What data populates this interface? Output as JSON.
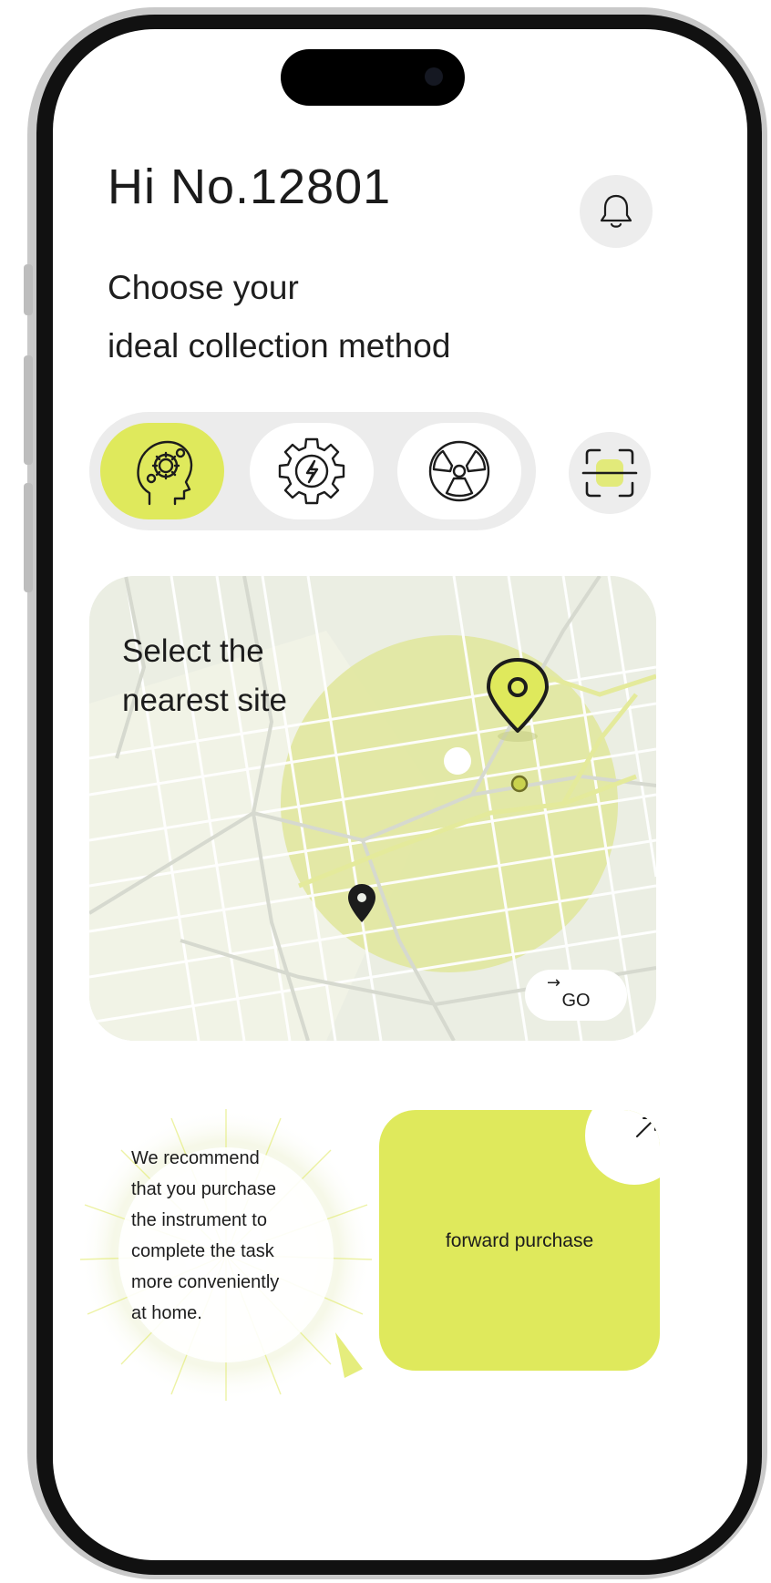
{
  "header": {
    "greeting": "Hi No.12801",
    "subtitle_line1": "Choose your",
    "subtitle_line2": "ideal collection method"
  },
  "icons": {
    "notifications": "bell-icon",
    "methods": [
      "brain-gear-icon",
      "power-gear-icon",
      "radiation-icon"
    ],
    "scan": "scan-icon",
    "map_pins": [
      "location-pin-icon",
      "location-pin-icon"
    ]
  },
  "methods": {
    "selected_index": 0
  },
  "map_card": {
    "title_line1": "Select the",
    "title_line2": "nearest site",
    "go_arrow": "→",
    "go_label": "GO"
  },
  "recommendation": {
    "line1": "We recommend",
    "line2": "that you purchase",
    "line3": "the instrument to",
    "line4": "complete the task",
    "line5": "more conveniently",
    "line6": "at home."
  },
  "purchase_card": {
    "label": "forward purchase",
    "arrow": "↗"
  },
  "colors": {
    "accent": "#dfe95c",
    "map_radius": "#e4ea9f",
    "text": "#1c1c1c",
    "chip_bg": "#ececec"
  }
}
